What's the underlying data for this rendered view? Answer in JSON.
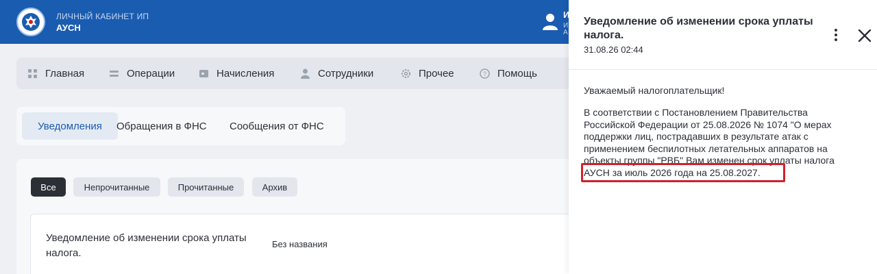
{
  "header": {
    "brand_sub": "ЛИЧНЫЙ КАБИНЕТ ИП",
    "brand_title": "АУСН",
    "user_initial": "И",
    "user_sub": "И",
    "user_sub2": "А"
  },
  "nav": {
    "items": [
      {
        "label": "Главная",
        "icon": "grid-icon"
      },
      {
        "label": "Операции",
        "icon": "list-icon"
      },
      {
        "label": "Начисления",
        "icon": "wallet-icon"
      },
      {
        "label": "Сотрудники",
        "icon": "person-icon"
      },
      {
        "label": "Прочее",
        "icon": "gear-icon"
      },
      {
        "label": "Помощь",
        "icon": "help-icon"
      }
    ]
  },
  "tabs": {
    "items": [
      {
        "label": "Уведомления",
        "active": true
      },
      {
        "label": "Обращения в ФНС",
        "active": false
      },
      {
        "label": "Сообщения от ФНС",
        "active": false
      }
    ]
  },
  "filters": {
    "items": [
      {
        "label": "Все",
        "active": true
      },
      {
        "label": "Непрочитанные",
        "active": false
      },
      {
        "label": "Прочитанные",
        "active": false
      },
      {
        "label": "Архив",
        "active": false
      }
    ]
  },
  "list": {
    "items": [
      {
        "title": "Уведомление об изменении срока уплаты налога.",
        "meta": "Без названия"
      }
    ]
  },
  "panel": {
    "title": "Уведомление об изменении срока уплаты налога.",
    "date": "31.08.26 02:44",
    "greeting": "Уважаемый налогоплательщик!",
    "body": "В соответствии с Постановлением Правительства Российской Федерации от 25.08.2026 № 1074 \"О мерах поддержки лиц, пострадавших в результате атак с применением беспилотных летательных аппаратов на объекты группы \"РВБ\" Вам изменен срок уплаты налога АУСН за июль 2026 года на 25.08.2027.",
    "highlight_color": "#d0202a"
  },
  "colors": {
    "brand": "#1a5cb0",
    "accent_text": "#1a5cb0",
    "dark": "#2b2f36"
  }
}
